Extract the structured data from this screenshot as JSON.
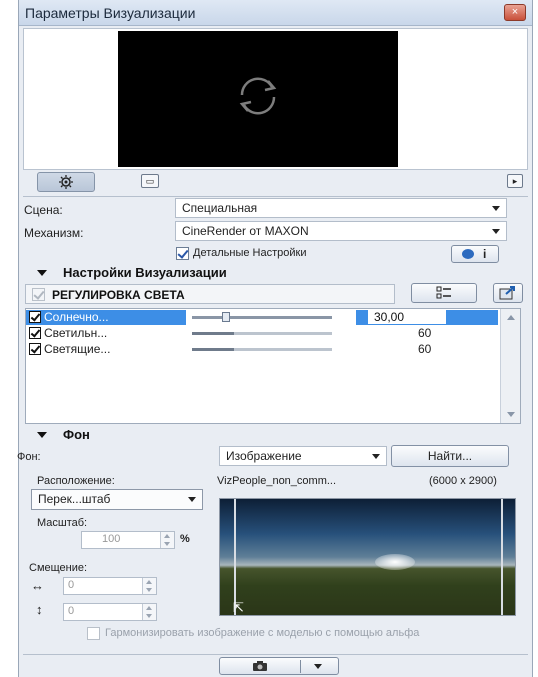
{
  "window": {
    "title": "Параметры Визуализации",
    "close_label": "×"
  },
  "scene": {
    "label": "Сцена:",
    "value": "Специальная"
  },
  "engine": {
    "label": "Механизм:",
    "value": "CineRender от MAXON"
  },
  "detailed": {
    "label": "Детальные Настройки",
    "checked": true
  },
  "render_settings": {
    "header": "Настройки Визуализации"
  },
  "light": {
    "header": "РЕГУЛИРОВКА СВЕТА",
    "rows": [
      {
        "name": "Солнечно...",
        "value": "30,00",
        "level": 0.25,
        "selected": true,
        "checked": true
      },
      {
        "name": "Светильн...",
        "value": "60",
        "level": 0.3,
        "selected": false,
        "checked": true
      },
      {
        "name": "Светящие...",
        "value": "60",
        "level": 0.3,
        "selected": false,
        "checked": true
      }
    ]
  },
  "background": {
    "header": "Фон",
    "label": "Фон:",
    "type_value": "Изображение",
    "find_button": "Найти...",
    "placement_label": "Расположение:",
    "file_name": "VizPeople_non_comm...",
    "file_size": "(6000 x 2900)",
    "placement_value": "Перек...штаб",
    "scale_label": "Масштаб:",
    "scale_value": "100",
    "scale_unit": "%",
    "offset_label": "Смещение:",
    "offset_h_icon": "↔",
    "offset_h": "0",
    "offset_v_icon": "↕",
    "offset_v": "0",
    "harmonize_label": "Гармонизировать изображение с моделью с помощью альфа"
  },
  "icons": {
    "refresh": "refresh-icon",
    "settings": "gear-icon",
    "size": "size-icon",
    "play": "play-icon",
    "info": "info-icon",
    "camera": "camera-icon"
  },
  "colors": {
    "selection": "#3d8ee6",
    "preview_bg": "#000000"
  }
}
